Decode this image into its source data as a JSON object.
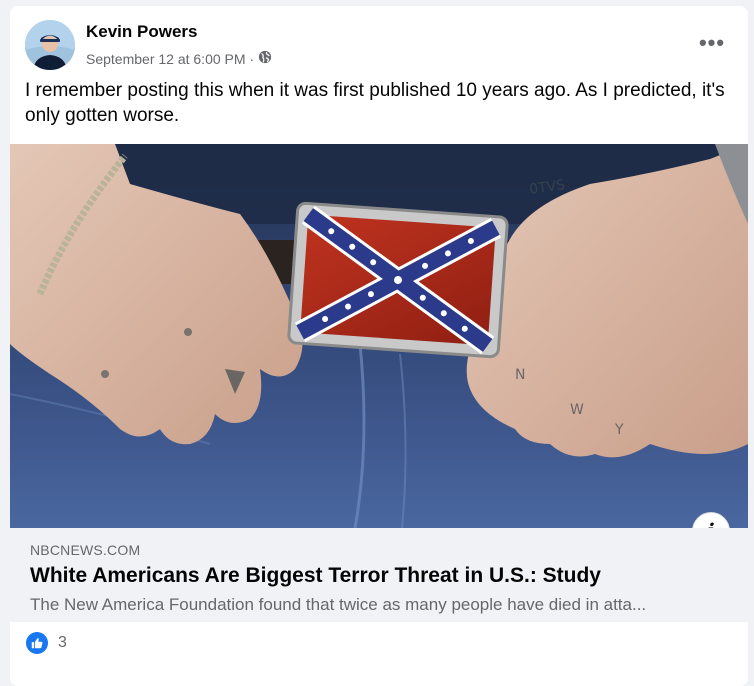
{
  "post": {
    "author": "Kevin Powers",
    "timestamp": "September 12 at 6:00 PM",
    "separator": "·",
    "privacy_icon": "globe-icon",
    "more_label": "•••",
    "text": "I remember posting this when it was first published 10 years ago. As I predicted, it's only gotten worse."
  },
  "link": {
    "domain": "NBCNEWS.COM",
    "title": "White Americans Are Biggest Terror Threat in U.S.: Study",
    "description": "The New America Foundation found that twice as many people have died in atta...",
    "info_label": "i"
  },
  "reactions": {
    "icon": "like-icon",
    "count": "3"
  },
  "colors": {
    "accent": "#1877f2",
    "secondary_text": "#65676b",
    "primary_text": "#050505",
    "preview_bg": "#f0f2f5"
  }
}
